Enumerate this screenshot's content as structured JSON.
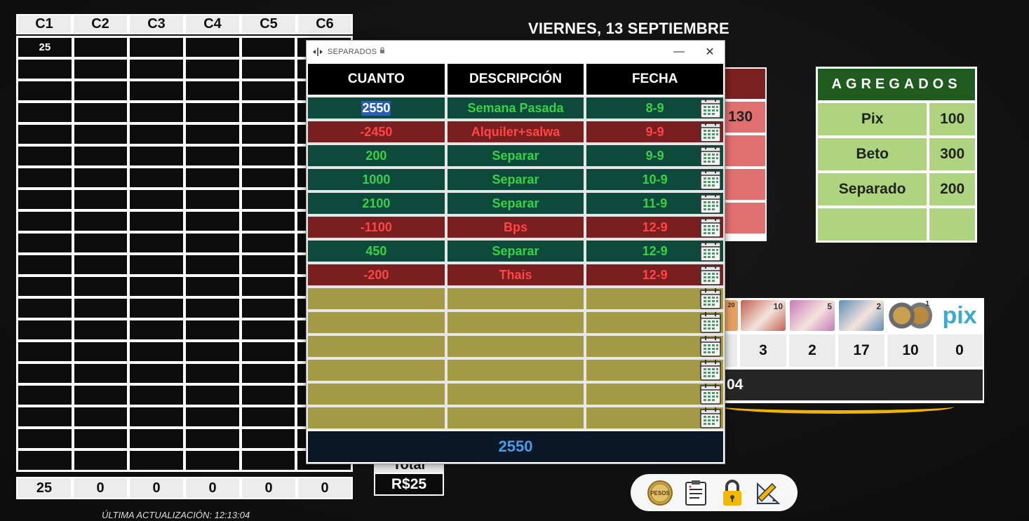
{
  "date_title": "VIERNES, 13 SEPTIEMBRE",
  "left_grid": {
    "columns": [
      "C1",
      "C2",
      "C3",
      "C4",
      "C5",
      "C6"
    ],
    "rows": [
      [
        "25",
        "",
        "",
        "",
        "",
        ""
      ],
      [
        "",
        "",
        "",
        "",
        "",
        ""
      ],
      [
        "",
        "",
        "",
        "",
        "",
        ""
      ],
      [
        "",
        "",
        "",
        "",
        "",
        ""
      ],
      [
        "",
        "",
        "",
        "",
        "",
        ""
      ],
      [
        "",
        "",
        "",
        "",
        "",
        ""
      ],
      [
        "",
        "",
        "",
        "",
        "",
        ""
      ],
      [
        "",
        "",
        "",
        "",
        "",
        ""
      ],
      [
        "",
        "",
        "",
        "",
        "",
        ""
      ],
      [
        "",
        "",
        "",
        "",
        "",
        ""
      ],
      [
        "",
        "",
        "",
        "",
        "",
        ""
      ],
      [
        "",
        "",
        "",
        "",
        "",
        ""
      ],
      [
        "",
        "",
        "",
        "",
        "",
        ""
      ],
      [
        "",
        "",
        "",
        "",
        "",
        ""
      ],
      [
        "",
        "",
        "",
        "",
        "",
        ""
      ],
      [
        "",
        "",
        "",
        "",
        "",
        ""
      ],
      [
        "",
        "",
        "",
        "",
        "",
        ""
      ],
      [
        "",
        "",
        "",
        "",
        "",
        ""
      ],
      [
        "",
        "",
        "",
        "",
        "",
        ""
      ],
      [
        "",
        "",
        "",
        "",
        "",
        ""
      ]
    ],
    "totals": [
      "25",
      "0",
      "0",
      "0",
      "0",
      "0"
    ]
  },
  "last_update": "ÚLTIMA ACTUALIZACIÓN: 12:13:04",
  "red_panel": {
    "visible_value": "130"
  },
  "agregados": {
    "title": "AGREGADOS",
    "rows": [
      {
        "name": "Pix",
        "value": "100"
      },
      {
        "name": "Beto",
        "value": "300"
      },
      {
        "name": "Separado",
        "value": "200"
      },
      {
        "name": "",
        "value": ""
      }
    ]
  },
  "money_panel": {
    "denominations": [
      {
        "label": "20",
        "color": "#e8a060"
      },
      {
        "label": "10",
        "color": "#c06050"
      },
      {
        "label": "5",
        "color": "#c878b8"
      },
      {
        "label": "2",
        "color": "#5f8fb5"
      },
      {
        "label": "1",
        "color": "#b59050"
      },
      {
        "label": "pix",
        "color": "#3fa8d0"
      }
    ],
    "counts": [
      "",
      "3",
      "2",
      "17",
      "10",
      "0"
    ],
    "total_partial": "04"
  },
  "total_box": {
    "label": "Total",
    "value": "R$25"
  },
  "toolbar": {
    "tools": [
      {
        "name": "pesos-coin-icon",
        "label": "PESOS"
      },
      {
        "name": "clipboard-icon",
        "label": ""
      },
      {
        "name": "lock-icon",
        "label": ""
      },
      {
        "name": "ruler-pencil-icon",
        "label": ""
      }
    ]
  },
  "window": {
    "title": "SEPARADOS",
    "minimize": "—",
    "close": "✕",
    "headers": [
      "CUANTO",
      "DESCRIPCIÓN",
      "FECHA"
    ],
    "rows": [
      {
        "amount": "2550",
        "desc": "Semana Pasada",
        "date": "8-9",
        "type": "pos",
        "selected": true
      },
      {
        "amount": "-2450",
        "desc": "Alquiler+salwa",
        "date": "9-9",
        "type": "neg"
      },
      {
        "amount": "200",
        "desc": "Separar",
        "date": "9-9",
        "type": "pos"
      },
      {
        "amount": "1000",
        "desc": "Separar",
        "date": "10-9",
        "type": "pos"
      },
      {
        "amount": "2100",
        "desc": "Separar",
        "date": "11-9",
        "type": "pos"
      },
      {
        "amount": "-1100",
        "desc": "Bps",
        "date": "12-9",
        "type": "neg"
      },
      {
        "amount": "450",
        "desc": "Separar",
        "date": "12-9",
        "type": "pos"
      },
      {
        "amount": "-200",
        "desc": "Thais",
        "date": "12-9",
        "type": "neg"
      },
      {
        "amount": "",
        "desc": "",
        "date": "",
        "type": "empty"
      },
      {
        "amount": "",
        "desc": "",
        "date": "",
        "type": "empty"
      },
      {
        "amount": "",
        "desc": "",
        "date": "",
        "type": "empty"
      },
      {
        "amount": "",
        "desc": "",
        "date": "",
        "type": "empty"
      },
      {
        "amount": "",
        "desc": "",
        "date": "",
        "type": "empty"
      },
      {
        "amount": "",
        "desc": "",
        "date": "",
        "type": "empty"
      }
    ],
    "total": "2550"
  },
  "colors": {
    "positive_bg": "#0d4a3c",
    "positive_text": "#3ad048",
    "negative_bg": "#7a1f1f",
    "negative_text": "#ff4545",
    "empty_bg": "#a49a45",
    "agregados_header": "#1f5a1f",
    "agregados_cell": "#aed480"
  }
}
